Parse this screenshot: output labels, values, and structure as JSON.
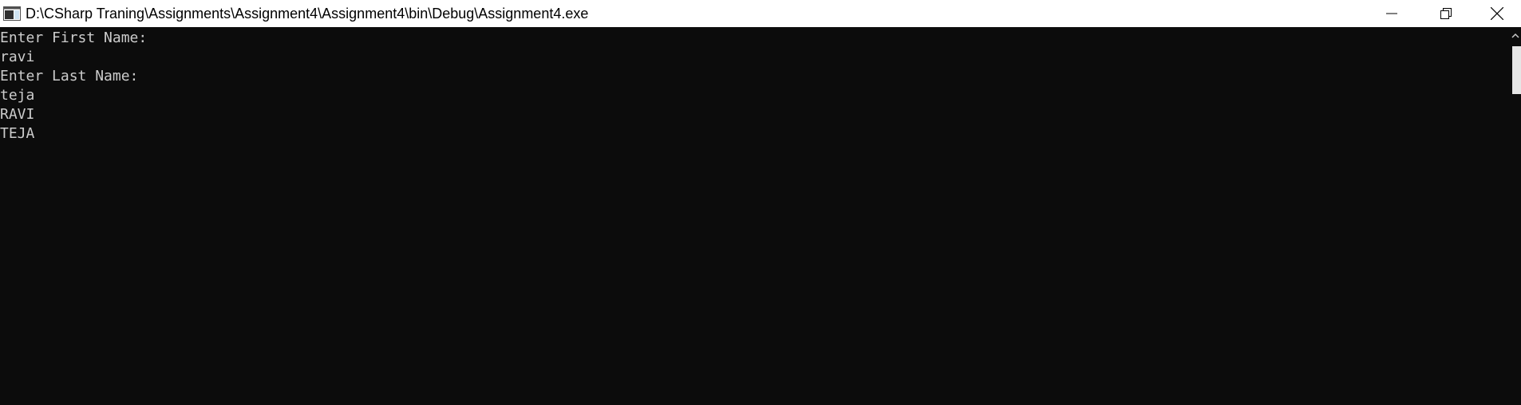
{
  "window": {
    "title": "D:\\CSharp Traning\\Assignments\\Assignment4\\Assignment4\\bin\\Debug\\Assignment4.exe"
  },
  "icons": {
    "app": "console-app-icon",
    "minimize": "minimize-icon",
    "maximize": "restore-icon",
    "close": "close-icon",
    "scroll_up": "chevron-up-icon"
  },
  "colors": {
    "console_bg": "#0c0c0c",
    "console_fg": "#cccccc",
    "titlebar_bg": "#ffffff"
  },
  "console": {
    "lines": [
      "Enter First Name:",
      "ravi",
      "Enter Last Name:",
      "teja",
      "RAVI",
      "TEJA"
    ]
  }
}
